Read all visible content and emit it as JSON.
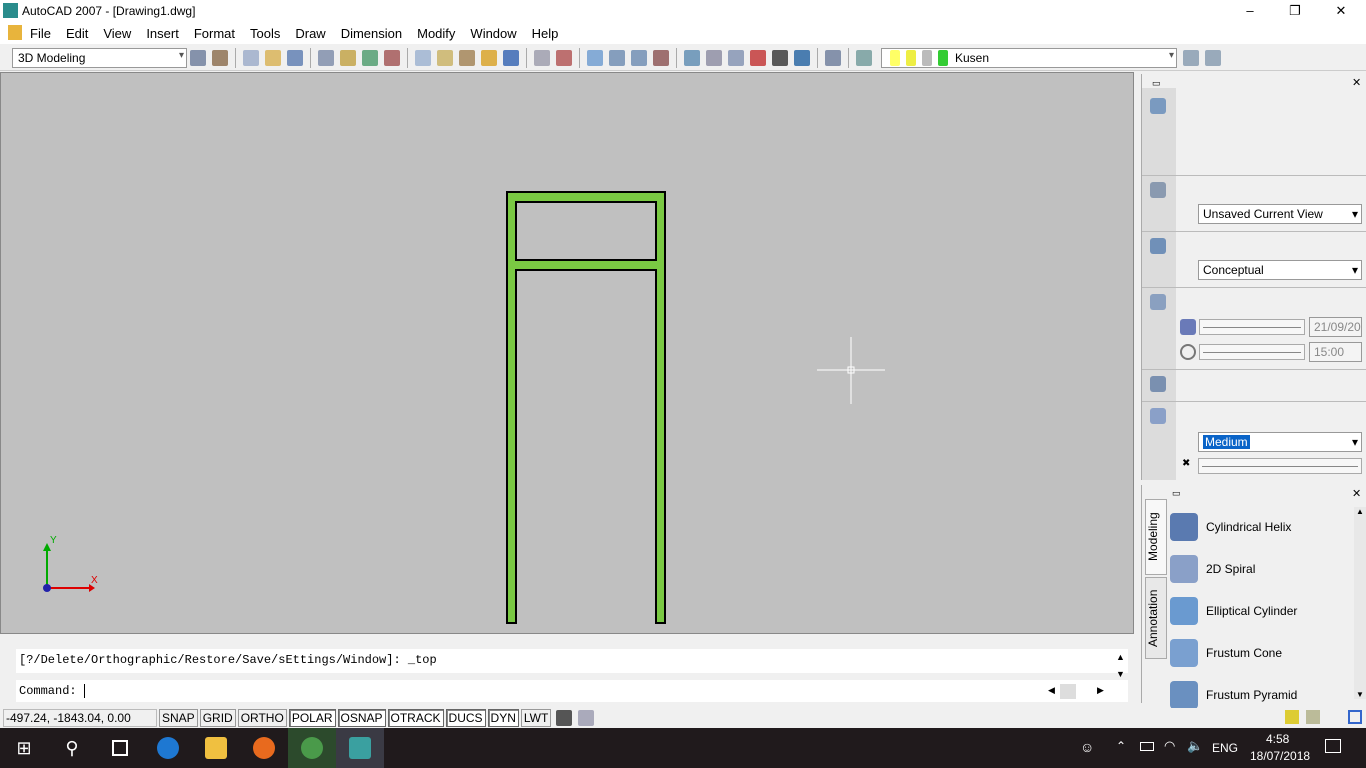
{
  "window": {
    "title": "AutoCAD 2007 - [Drawing1.dwg]",
    "minimize": "–",
    "restore": "❐",
    "close": "✕"
  },
  "menu": [
    "File",
    "Edit",
    "View",
    "Insert",
    "Format",
    "Tools",
    "Draw",
    "Dimension",
    "Modify",
    "Window",
    "Help"
  ],
  "toolbar": {
    "workspace": "3D Modeling",
    "layer": "Kusen",
    "icons": [
      "workspace-settings-icon",
      "my-workspace-icon",
      "new-icon",
      "open-icon",
      "save-icon",
      "plot-icon",
      "plot-preview-icon",
      "publish-icon",
      "3d-dwf-icon",
      "cut-icon",
      "copy-icon",
      "paste-icon",
      "match-properties-icon",
      "block-editor-icon",
      "undo-icon",
      "redo-icon",
      "pan-icon",
      "zoom-realtime-icon",
      "zoom-window-icon",
      "zoom-previous-icon",
      "properties-icon",
      "design-center-icon",
      "tool-palettes-icon",
      "sheet-set-icon",
      "markup-icon",
      "calculator-icon",
      "help-icon"
    ]
  },
  "dashboard": {
    "view": "Unsaved Current View",
    "visual_style": "Conceptual",
    "date": "21/09/20",
    "time": "15:00",
    "render_quality": "Medium"
  },
  "palette": {
    "tabs": [
      "Modeling",
      "Annotation"
    ],
    "items": [
      "Cylindrical Helix",
      "2D Spiral",
      "Elliptical Cylinder",
      "Frustum Cone",
      "Frustum Pyramid"
    ]
  },
  "command": {
    "history": "[?/Delete/Orthographic/Restore/Save/sEttings/Window]: _top",
    "prompt": "Command:"
  },
  "status": {
    "coords": "-497.24, -1843.04, 0.00",
    "toggles": [
      "SNAP",
      "GRID",
      "ORTHO",
      "POLAR",
      "OSNAP",
      "OTRACK",
      "DUCS",
      "DYN",
      "LWT"
    ],
    "on": [
      "POLAR",
      "OSNAP",
      "OTRACK",
      "DUCS",
      "DYN"
    ]
  },
  "ucs": {
    "x": "X",
    "y": "Y"
  },
  "taskbar": {
    "time": "4:58",
    "date": "18/07/2018",
    "lang": "ENG"
  },
  "colors": {
    "frame": "#7ac943",
    "canvas": "#c0c0c0",
    "selection": "#0a64c8"
  }
}
